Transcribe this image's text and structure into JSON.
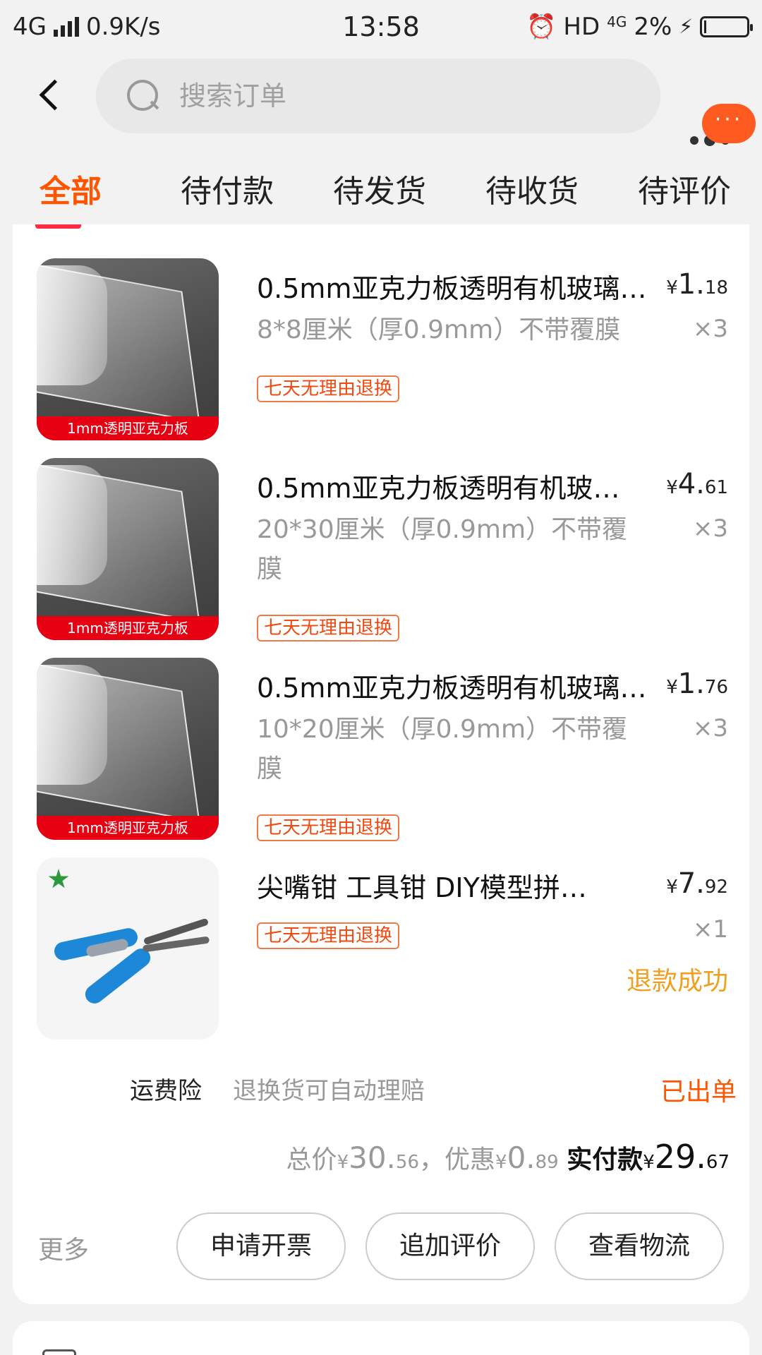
{
  "status": {
    "network": "4G",
    "speed": "0.9K/s",
    "time": "13:58",
    "hd": "HD",
    "net2": "4G",
    "battery": "2%"
  },
  "header": {
    "search_placeholder": "搜索订单",
    "message_dots": "···"
  },
  "tabs": [
    {
      "label": "全部",
      "active": true
    },
    {
      "label": "待付款"
    },
    {
      "label": "待发货"
    },
    {
      "label": "待收货"
    },
    {
      "label": "待评价"
    }
  ],
  "items": [
    {
      "title": "0.5mm亚克力板透明有机玻璃…",
      "price_int": "1.",
      "price_frac": "18",
      "currency": "¥",
      "spec": "8*8厘米（厚0.9mm）不带覆膜",
      "qty": "×3",
      "tag": "七天无理由退换",
      "banner": "1mm透明亚克力板"
    },
    {
      "title": "0.5mm亚克力板透明有机玻…",
      "price_int": "4.",
      "price_frac": "61",
      "currency": "¥",
      "spec": "20*30厘米（厚0.9mm）不带覆膜",
      "qty": "×3",
      "tag": "七天无理由退换",
      "banner": "1mm透明亚克力板"
    },
    {
      "title": "0.5mm亚克力板透明有机玻璃…",
      "price_int": "1.",
      "price_frac": "76",
      "currency": "¥",
      "spec": "10*20厘米（厚0.9mm）不带覆膜",
      "qty": "×3",
      "tag": "七天无理由退换",
      "banner": "1mm透明亚克力板"
    },
    {
      "title": "尖嘴钳 工具钳 DIY模型拼…",
      "price_int": "7.",
      "price_frac": "92",
      "currency": "¥",
      "qty": "×1",
      "tag": "七天无理由退换",
      "refund_status": "退款成功"
    }
  ],
  "insurance": {
    "label": "运费险",
    "description": "退换货可自动理赔",
    "status": "已出单"
  },
  "totals": {
    "total_label": "总价",
    "total_int": "30.",
    "total_frac": "56",
    "discount_label": "，优惠",
    "discount_int": "0.",
    "discount_frac": "89",
    "paid_label": "实付款",
    "paid_int": "29.",
    "paid_frac": "67",
    "currency": "¥"
  },
  "actions": {
    "more": "更多",
    "invoice": "申请开票",
    "add_review": "追加评价",
    "logistics": "查看物流"
  },
  "colors": {
    "accent": "#ff5500",
    "tag_border": "#f07a47",
    "refund": "#f0a020"
  }
}
